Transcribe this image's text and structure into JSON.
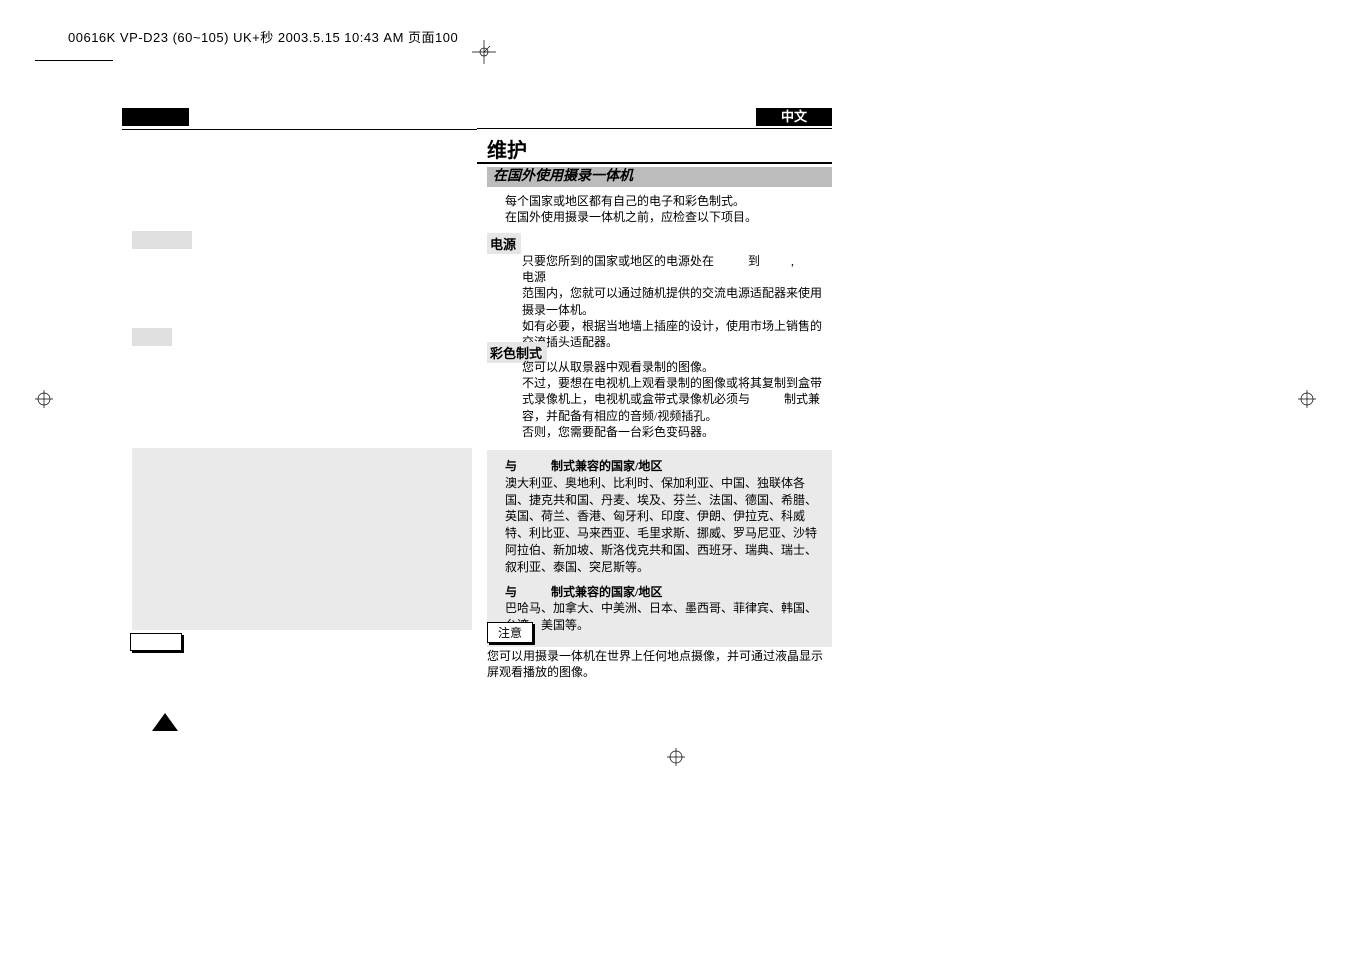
{
  "header": {
    "filename": "00616K VP-D23 (60~105) UK+秒 2003.5.15 10:43 AM 页面100"
  },
  "right": {
    "lang": "中文",
    "title": "维护",
    "subsection": "在国外使用摄录一体机",
    "intro_line1": "每个国家或地区都有自己的电子和彩色制式。",
    "intro_line2": "在国外使用摄录一体机之前，应检查以下项目。",
    "power_label": "电源",
    "power_body1": "只要您所到的国家或地区的电源处在",
    "power_body1_mid": "到",
    "power_body1_end": "电源",
    "power_body2": "范围内，您就可以通过随机提供的交流电源适配器来使用摄录一体机。",
    "power_body3": "如有必要，根据当地墙上插座的设计，使用市场上销售的交流插头适配器。",
    "color_label": "彩色制式",
    "color_body1": "您可以从取景器中观看录制的图像。",
    "color_body2": "不过，要想在电视机上观看录制的图像或将其复制到盒带式录像机上，电视机或盒带式录像机必须与",
    "color_body2_end": "制式兼容，并配备有相应的音频/视频插孔。",
    "color_body3": "否则，您需要配备一台彩色变码器。",
    "compat1_head_a": "与",
    "compat1_head_b": "制式兼容的国家/地区",
    "compat1_body": "澳大利亚、奥地利、比利时、保加利亚、中国、独联体各国、捷克共和国、丹麦、埃及、芬兰、法国、德国、希腊、英国、荷兰、香港、匈牙利、印度、伊朗、伊拉克、科威特、利比亚、马来西亚、毛里求斯、挪威、罗马尼亚、沙特阿拉伯、新加坡、斯洛伐克共和国、西班牙、瑞典、瑞士、叙利亚、泰国、突尼斯等。",
    "compat2_head_a": "与",
    "compat2_head_b": "制式兼容的国家/地区",
    "compat2_body": "巴哈马、加拿大、中美洲、日本、墨西哥、菲律宾、韩国、台湾、美国等。",
    "note_label": "注意",
    "note_body": "您可以用摄录一体机在世界上任何地点摄像，并可通过液晶显示屏观看播放的图像。"
  }
}
